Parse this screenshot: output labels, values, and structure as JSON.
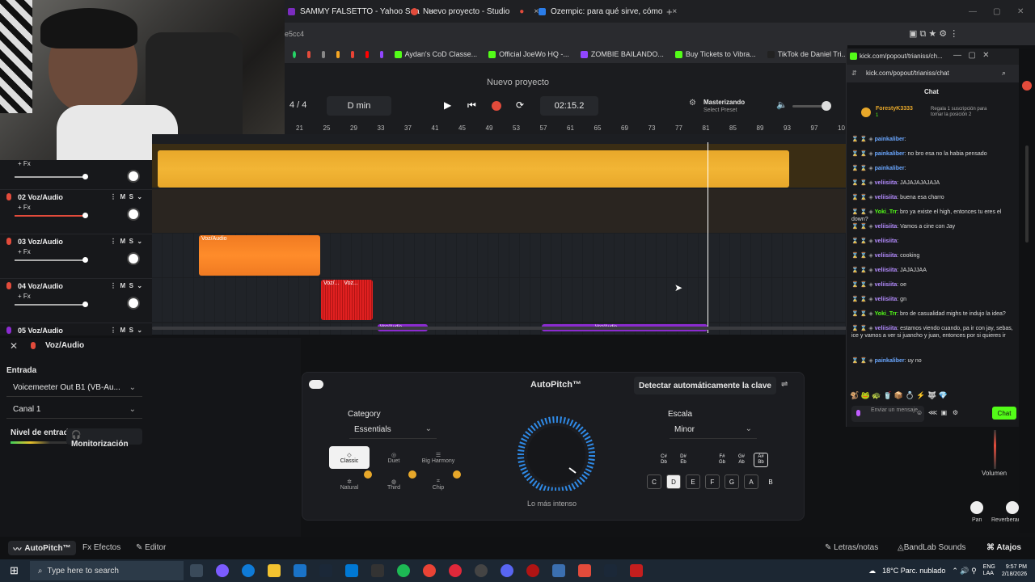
{
  "browser": {
    "tabs": [
      {
        "label": "SAMMY FALSETTO - Yahoo Sea",
        "color": "#7b2cbf"
      },
      {
        "label": "Nuevo proyecto - Studio",
        "color": "#e24b3b"
      },
      {
        "label": "Ozempic: para qué sirve, cómo",
        "color": "#2b7de9"
      }
    ],
    "address_fragment": "e5cc4",
    "bookmarks": [
      "Aydan's CoD Classe...",
      "Official JoeWo HQ -...",
      "ZOMBIE BAILANDO...",
      "Buy Tickets to Vibra...",
      "TikTok de Daniel Tri..."
    ]
  },
  "studio": {
    "project_title": "Nuevo proyecto",
    "time_signature": "4 / 4",
    "key": "D min",
    "time": "02:15.2",
    "mastering_label": "Masterizando",
    "preset_label": "Select Preset",
    "ruler": [
      "21",
      "25",
      "29",
      "33",
      "37",
      "41",
      "45",
      "49",
      "53",
      "57",
      "61",
      "65",
      "69",
      "73",
      "77",
      "81",
      "85",
      "89",
      "93",
      "97",
      "10"
    ],
    "tracks": [
      {
        "number": "",
        "name": "",
        "fx": "+ Fx"
      },
      {
        "number": "02",
        "name": "Voz/Audio",
        "fx": "+ Fx"
      },
      {
        "number": "03",
        "name": "Voz/Audio",
        "fx": "+ Fx"
      },
      {
        "number": "04",
        "name": "Voz/Audio",
        "fx": "+ Fx"
      },
      {
        "number": "05",
        "name": "Voz/Audio",
        "fx": ""
      }
    ],
    "mute_label": "M",
    "solo_label": "S",
    "clips": {
      "clip3": "Voz/Audio",
      "clip4a": "Voz/...",
      "clip4b": "Voz...",
      "clip5a": "Voz/Audio",
      "clip5b": "Voz/Audio"
    }
  },
  "input_panel": {
    "header": "Voz/Audio",
    "entrada_label": "Entrada",
    "input_device": "Voicemeeter Out B1 (VB-Au...",
    "channel": "Canal 1",
    "level_label": "Nivel de entrada",
    "monitor_label": "Monitorización"
  },
  "autopitch": {
    "title": "AutoPitch™",
    "detect_label": "Detectar automáticamente la clave",
    "category_label": "Category",
    "category_value": "Essentials",
    "presets": [
      "Classic",
      "Duet",
      "Big Harmony",
      "Natural",
      "Third",
      "Chip"
    ],
    "intensity_label": "Lo más intenso",
    "scale_label": "Escala",
    "scale_value": "Minor",
    "sharp_notes": [
      "C#\nDb",
      "D#\nEb",
      "F#\nGb",
      "G#\nAb",
      "A#\nBb"
    ],
    "notes": [
      "C",
      "D",
      "E",
      "F",
      "G",
      "A",
      "B"
    ]
  },
  "bottombar": {
    "autopitch_tab": "AutoPitch™",
    "effects_tab": "Efectos",
    "editor_tab": "Editor",
    "lyrics": "Letras/notas",
    "sounds": "BandLab Sounds",
    "shortcuts": "Atajos"
  },
  "mixer": {
    "volume_label": "Volumen",
    "pan_label": "Pan",
    "reverb_label": "Reverberación"
  },
  "chat": {
    "url": "kick.com/popout/trianiss/ch...",
    "address": "kick.com/popout/trianiss/chat",
    "title": "Chat",
    "top_user": "ForestyK3333",
    "top_count": "1",
    "gift_text": "Regala 1 suscripción para tomar la posición 2",
    "messages": [
      {
        "user": "painkaliber",
        "text": ":",
        "color": "#6aa7ff"
      },
      {
        "user": "painkaliber",
        "text": ": no bro esa no la habia pensado",
        "color": "#6aa7ff"
      },
      {
        "user": "painkaliber",
        "text": ":",
        "color": "#6aa7ff"
      },
      {
        "user": "veliisiita",
        "text": ": JAJAJAJAJAJA",
        "color": "#b48cff"
      },
      {
        "user": "veliisiita",
        "text": ": buena esa charro",
        "color": "#b48cff"
      },
      {
        "user": "Yoki_Trr",
        "text": ": bro ya existe el high, entonces tu eres el down?",
        "color": "#53fc18"
      },
      {
        "user": "veliisiita",
        "text": ": Vamos a cine con Jay",
        "color": "#b48cff"
      },
      {
        "user": "veliisiita",
        "text": ":",
        "color": "#b48cff"
      },
      {
        "user": "veliisiita",
        "text": ": cooking",
        "color": "#b48cff"
      },
      {
        "user": "veliisiita",
        "text": ": JAJAJJAA",
        "color": "#b48cff"
      },
      {
        "user": "veliisiita",
        "text": ": oe",
        "color": "#b48cff"
      },
      {
        "user": "veliisiita",
        "text": ": gn",
        "color": "#b48cff"
      },
      {
        "user": "Yoki_Trr",
        "text": ": bro de casualidad mighs te indujo la idea?",
        "color": "#53fc18"
      },
      {
        "user": "veliisiita",
        "text": ": estamos viendo cuando, pa ir con jay, sebas, ice y vamos a ver si juancho y juan, entonces por si quieres ir",
        "color": "#b48cff"
      },
      {
        "user": "painkaliber",
        "text": ": uy no",
        "color": "#6aa7ff"
      }
    ],
    "send_placeholder": "Enviar un mensaje",
    "send_button": "Chat"
  },
  "taskbar": {
    "search_placeholder": "Type here to search",
    "weather": "18°C  Parc. nublado",
    "lang": "ENG\nLAA",
    "clock_time": "9:57 PM",
    "clock_date": "2/18/2026"
  }
}
